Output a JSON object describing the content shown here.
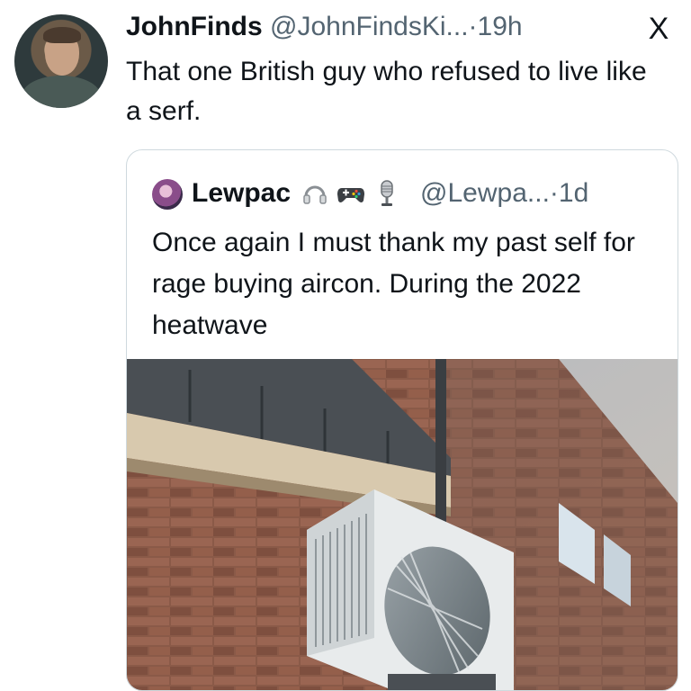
{
  "post": {
    "author_name": "JohnFinds",
    "handle": "@JohnFindsKi...",
    "separator": "·",
    "time": "19h",
    "text": "That one British guy who refused to live like a serf."
  },
  "close_icon": "X",
  "quoted": {
    "author_name": "Lewpac",
    "badges": [
      "headphones-icon",
      "gamepad-icon",
      "microphone-icon"
    ],
    "handle": "@Lewpa...",
    "separator": "·",
    "time": "1d",
    "text": "Once again I must thank my past self for rage buying aircon. During the 2022 heatwave",
    "image": "outdoor air-conditioning unit mounted on a brick wall"
  },
  "colors": {
    "text": "#0f1419",
    "muted": "#536471",
    "border": "#cfd9de"
  }
}
